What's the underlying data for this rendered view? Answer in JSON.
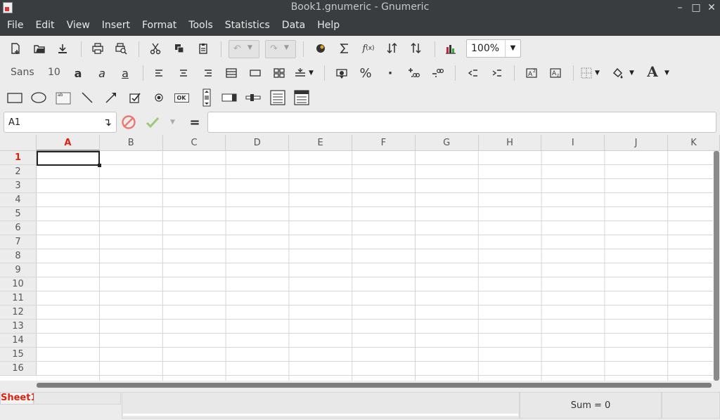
{
  "window": {
    "title": "Book1.gnumeric - Gnumeric",
    "minimize": "–",
    "maximize": "□",
    "close": "✕"
  },
  "menubar": {
    "items": [
      "File",
      "Edit",
      "View",
      "Insert",
      "Format",
      "Tools",
      "Statistics",
      "Data",
      "Help"
    ]
  },
  "toolbar1": {
    "zoom": "100%"
  },
  "toolbar2": {
    "font_name": "Sans",
    "font_size": "10",
    "bold": "a",
    "italic": "a",
    "underline": "a",
    "percent": "%",
    "thousands": "·",
    "font_color": "A"
  },
  "toolbar3": {
    "ok_label": "OK"
  },
  "formulabar": {
    "cell_ref": "A1",
    "equals": "=",
    "formula": ""
  },
  "grid": {
    "columns": [
      "A",
      "B",
      "C",
      "D",
      "E",
      "F",
      "G",
      "H",
      "I",
      "J",
      "K"
    ],
    "rows": [
      "1",
      "2",
      "3",
      "4",
      "5",
      "6",
      "7",
      "8",
      "9",
      "10",
      "11",
      "12",
      "13",
      "14",
      "15",
      "16"
    ],
    "active_column": "A",
    "active_row": "1"
  },
  "statusbar": {
    "sheet_tab": "Sheet1",
    "sum": "Sum = 0"
  },
  "colors": {
    "titlebar_bg": "#3a3d40",
    "active_header": "#dd2211",
    "grid_line": "#d6d6d6"
  }
}
